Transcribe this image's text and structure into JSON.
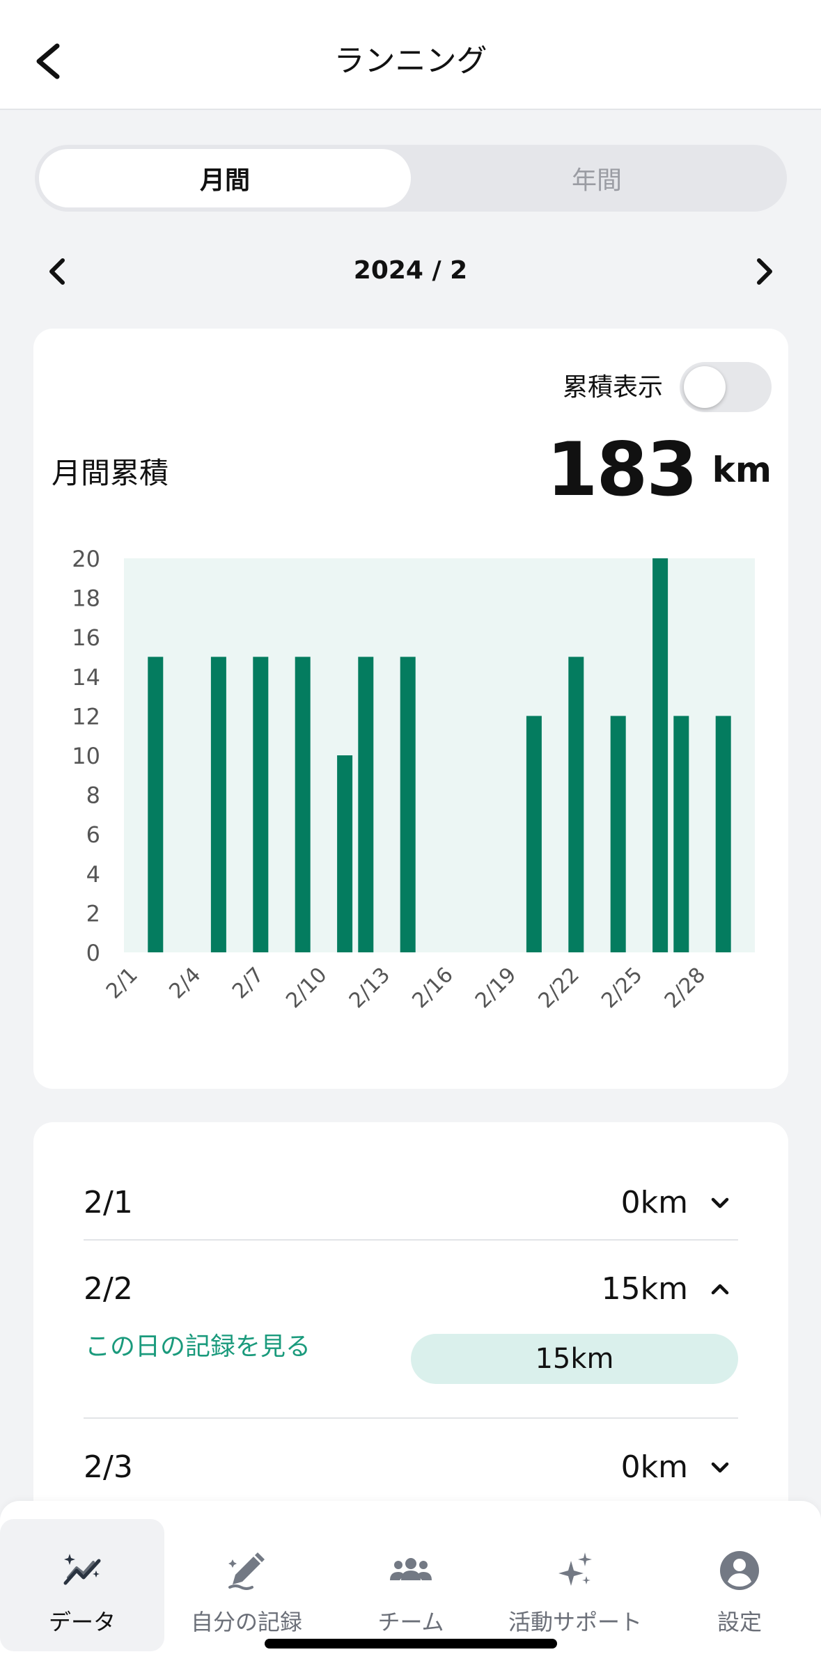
{
  "header": {
    "title": "ランニング"
  },
  "segment": {
    "monthly": "月間",
    "yearly": "年間"
  },
  "month_nav": {
    "label": "2024 / 2"
  },
  "summary": {
    "toggle_label": "累積表示",
    "total_label": "月間累積",
    "total_value": "183",
    "total_unit": "km"
  },
  "chart_data": {
    "type": "bar",
    "x": [
      1,
      2,
      3,
      4,
      5,
      6,
      7,
      8,
      9,
      10,
      11,
      12,
      13,
      14,
      15,
      16,
      17,
      18,
      19,
      20,
      21,
      22,
      23,
      24,
      25,
      26,
      27,
      28,
      29
    ],
    "values": [
      0,
      15,
      0,
      0,
      15,
      0,
      15,
      0,
      15,
      0,
      10,
      15,
      0,
      15,
      0,
      0,
      0,
      0,
      0,
      12,
      0,
      15,
      0,
      12,
      0,
      20,
      12,
      0,
      12
    ],
    "xticklabels": [
      "2/1",
      "2/4",
      "2/7",
      "2/10",
      "2/13",
      "2/16",
      "2/19",
      "2/22",
      "2/25",
      "2/28"
    ],
    "xtick_days": [
      1,
      4,
      7,
      10,
      13,
      16,
      19,
      22,
      25,
      28
    ],
    "yticks": [
      0,
      2,
      4,
      6,
      8,
      10,
      12,
      14,
      16,
      18,
      20
    ],
    "ylim": [
      0,
      20
    ],
    "xlim": [
      0.5,
      30.5
    ],
    "bar_color": "#047c5f",
    "plot_bg": "#ecf6f4"
  },
  "list": {
    "rows": [
      {
        "date": "2/1",
        "value": "0km"
      },
      {
        "date": "2/2",
        "value": "15km"
      },
      {
        "date": "2/3",
        "value": "0km"
      }
    ],
    "record_link": "この日の記録を見る",
    "expanded_value": "15km"
  },
  "tabs": [
    {
      "label": "データ"
    },
    {
      "label": "自分の記録"
    },
    {
      "label": "チーム"
    },
    {
      "label": "活動サポート"
    },
    {
      "label": "設定"
    }
  ]
}
